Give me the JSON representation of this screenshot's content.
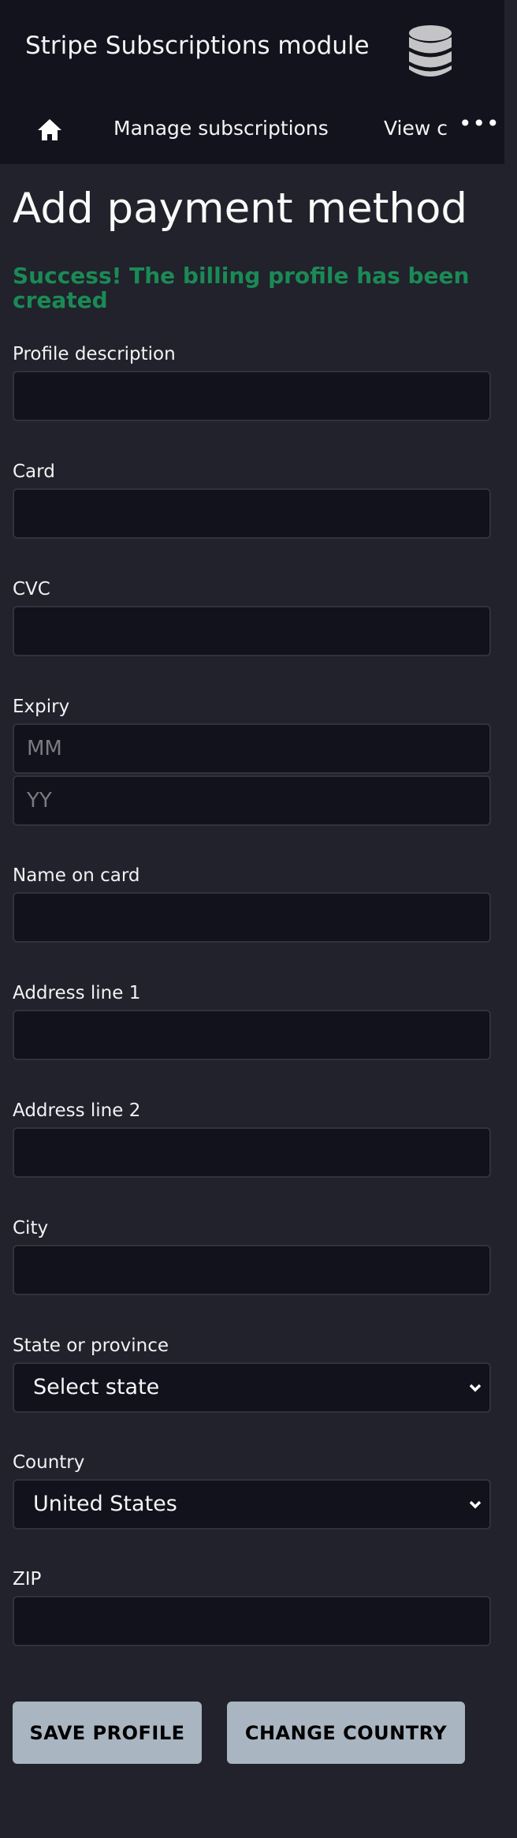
{
  "header": {
    "title": "Stripe Subscriptions module",
    "logo_icon": "database-icon",
    "nav": {
      "home_icon": "home-icon",
      "items": [
        {
          "label": "Manage subscriptions"
        },
        {
          "label": "View c"
        }
      ],
      "more_label": "•••"
    }
  },
  "page": {
    "title": "Add payment method",
    "success_message": "Success! The billing profile has been created",
    "success_color": "#1b8a56"
  },
  "form": {
    "profile_description": {
      "label": "Profile description",
      "value": ""
    },
    "card": {
      "label": "Card",
      "value": ""
    },
    "cvc": {
      "label": "CVC",
      "value": ""
    },
    "expiry": {
      "label": "Expiry",
      "month_placeholder": "MM",
      "year_placeholder": "YY"
    },
    "name_on_card": {
      "label": "Name on card",
      "value": ""
    },
    "address1": {
      "label": "Address line 1",
      "value": ""
    },
    "address2": {
      "label": "Address line 2",
      "value": ""
    },
    "city": {
      "label": "City",
      "value": ""
    },
    "state": {
      "label": "State or province",
      "selected": "Select state"
    },
    "country": {
      "label": "Country",
      "selected": "United States"
    },
    "zip": {
      "label": "ZIP",
      "value": ""
    }
  },
  "buttons": {
    "save": "SAVE PROFILE",
    "change_country": "CHANGE COUNTRY"
  }
}
